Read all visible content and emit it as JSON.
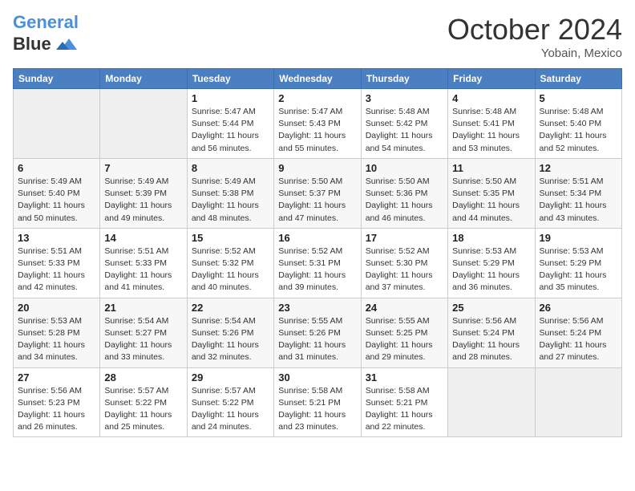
{
  "header": {
    "logo_line1": "General",
    "logo_line2": "Blue",
    "month": "October 2024",
    "location": "Yobain, Mexico"
  },
  "weekdays": [
    "Sunday",
    "Monday",
    "Tuesday",
    "Wednesday",
    "Thursday",
    "Friday",
    "Saturday"
  ],
  "weeks": [
    [
      {
        "day": "",
        "info": ""
      },
      {
        "day": "",
        "info": ""
      },
      {
        "day": "1",
        "info": "Sunrise: 5:47 AM\nSunset: 5:44 PM\nDaylight: 11 hours and 56 minutes."
      },
      {
        "day": "2",
        "info": "Sunrise: 5:47 AM\nSunset: 5:43 PM\nDaylight: 11 hours and 55 minutes."
      },
      {
        "day": "3",
        "info": "Sunrise: 5:48 AM\nSunset: 5:42 PM\nDaylight: 11 hours and 54 minutes."
      },
      {
        "day": "4",
        "info": "Sunrise: 5:48 AM\nSunset: 5:41 PM\nDaylight: 11 hours and 53 minutes."
      },
      {
        "day": "5",
        "info": "Sunrise: 5:48 AM\nSunset: 5:40 PM\nDaylight: 11 hours and 52 minutes."
      }
    ],
    [
      {
        "day": "6",
        "info": "Sunrise: 5:49 AM\nSunset: 5:40 PM\nDaylight: 11 hours and 50 minutes."
      },
      {
        "day": "7",
        "info": "Sunrise: 5:49 AM\nSunset: 5:39 PM\nDaylight: 11 hours and 49 minutes."
      },
      {
        "day": "8",
        "info": "Sunrise: 5:49 AM\nSunset: 5:38 PM\nDaylight: 11 hours and 48 minutes."
      },
      {
        "day": "9",
        "info": "Sunrise: 5:50 AM\nSunset: 5:37 PM\nDaylight: 11 hours and 47 minutes."
      },
      {
        "day": "10",
        "info": "Sunrise: 5:50 AM\nSunset: 5:36 PM\nDaylight: 11 hours and 46 minutes."
      },
      {
        "day": "11",
        "info": "Sunrise: 5:50 AM\nSunset: 5:35 PM\nDaylight: 11 hours and 44 minutes."
      },
      {
        "day": "12",
        "info": "Sunrise: 5:51 AM\nSunset: 5:34 PM\nDaylight: 11 hours and 43 minutes."
      }
    ],
    [
      {
        "day": "13",
        "info": "Sunrise: 5:51 AM\nSunset: 5:33 PM\nDaylight: 11 hours and 42 minutes."
      },
      {
        "day": "14",
        "info": "Sunrise: 5:51 AM\nSunset: 5:33 PM\nDaylight: 11 hours and 41 minutes."
      },
      {
        "day": "15",
        "info": "Sunrise: 5:52 AM\nSunset: 5:32 PM\nDaylight: 11 hours and 40 minutes."
      },
      {
        "day": "16",
        "info": "Sunrise: 5:52 AM\nSunset: 5:31 PM\nDaylight: 11 hours and 39 minutes."
      },
      {
        "day": "17",
        "info": "Sunrise: 5:52 AM\nSunset: 5:30 PM\nDaylight: 11 hours and 37 minutes."
      },
      {
        "day": "18",
        "info": "Sunrise: 5:53 AM\nSunset: 5:29 PM\nDaylight: 11 hours and 36 minutes."
      },
      {
        "day": "19",
        "info": "Sunrise: 5:53 AM\nSunset: 5:29 PM\nDaylight: 11 hours and 35 minutes."
      }
    ],
    [
      {
        "day": "20",
        "info": "Sunrise: 5:53 AM\nSunset: 5:28 PM\nDaylight: 11 hours and 34 minutes."
      },
      {
        "day": "21",
        "info": "Sunrise: 5:54 AM\nSunset: 5:27 PM\nDaylight: 11 hours and 33 minutes."
      },
      {
        "day": "22",
        "info": "Sunrise: 5:54 AM\nSunset: 5:26 PM\nDaylight: 11 hours and 32 minutes."
      },
      {
        "day": "23",
        "info": "Sunrise: 5:55 AM\nSunset: 5:26 PM\nDaylight: 11 hours and 31 minutes."
      },
      {
        "day": "24",
        "info": "Sunrise: 5:55 AM\nSunset: 5:25 PM\nDaylight: 11 hours and 29 minutes."
      },
      {
        "day": "25",
        "info": "Sunrise: 5:56 AM\nSunset: 5:24 PM\nDaylight: 11 hours and 28 minutes."
      },
      {
        "day": "26",
        "info": "Sunrise: 5:56 AM\nSunset: 5:24 PM\nDaylight: 11 hours and 27 minutes."
      }
    ],
    [
      {
        "day": "27",
        "info": "Sunrise: 5:56 AM\nSunset: 5:23 PM\nDaylight: 11 hours and 26 minutes."
      },
      {
        "day": "28",
        "info": "Sunrise: 5:57 AM\nSunset: 5:22 PM\nDaylight: 11 hours and 25 minutes."
      },
      {
        "day": "29",
        "info": "Sunrise: 5:57 AM\nSunset: 5:22 PM\nDaylight: 11 hours and 24 minutes."
      },
      {
        "day": "30",
        "info": "Sunrise: 5:58 AM\nSunset: 5:21 PM\nDaylight: 11 hours and 23 minutes."
      },
      {
        "day": "31",
        "info": "Sunrise: 5:58 AM\nSunset: 5:21 PM\nDaylight: 11 hours and 22 minutes."
      },
      {
        "day": "",
        "info": ""
      },
      {
        "day": "",
        "info": ""
      }
    ]
  ]
}
